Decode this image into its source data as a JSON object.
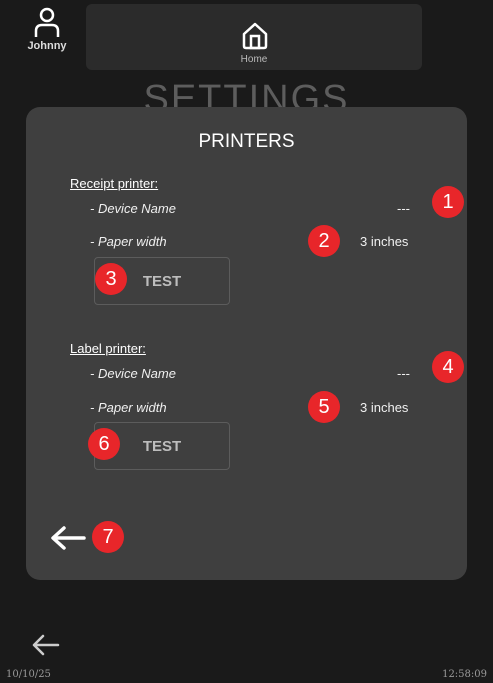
{
  "header": {
    "user_name": "Johnny",
    "home_label": "Home"
  },
  "page_title": "SETTINGS",
  "panel": {
    "title": "PRINTERS",
    "receipt": {
      "section": "Receipt printer:",
      "device_label": "- Device Name",
      "device_value": "---",
      "paper_label": "- Paper width",
      "paper_value": "3 inches",
      "test_label": "TEST"
    },
    "label": {
      "section": "Label printer:",
      "device_label": "- Device Name",
      "device_value": "---",
      "paper_label": "- Paper width",
      "paper_value": "3 inches",
      "test_label": "TEST"
    }
  },
  "badges": [
    "1",
    "2",
    "3",
    "4",
    "5",
    "6",
    "7"
  ],
  "footer": {
    "date": "10/10/25",
    "time": "12:58:09"
  },
  "icons": [
    "user-icon",
    "home-icon",
    "back-arrow-icon"
  ],
  "colors": {
    "background": "#1a1a1a",
    "panel": "#3f3f3f",
    "badge": "#e8262a"
  }
}
